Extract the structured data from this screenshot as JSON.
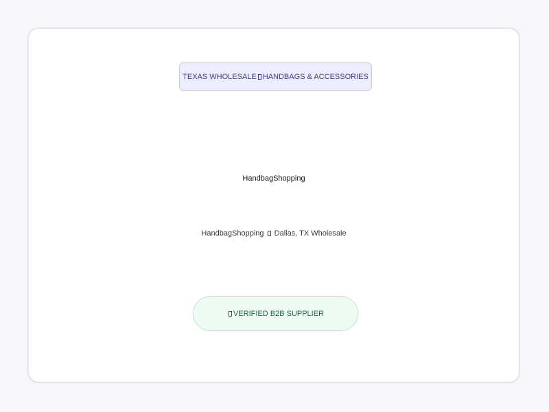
{
  "top_badge": {
    "left_text": "TEXAS WHOLESALE",
    "right_text": "HANDBAGS & ACCESSORIES"
  },
  "brand": {
    "title": "HandbagShopping"
  },
  "subtitle": {
    "left_text": "HandbagShopping",
    "right_text": "Dallas, TX Wholesale"
  },
  "verified_badge": {
    "label": "VERIFIED B2B SUPPLIER"
  },
  "colors": {
    "page_bg": "#f6f7fa",
    "card_bg": "#ffffff",
    "top_badge_bg": "#eceefd",
    "top_badge_text": "#3b3f8f",
    "verified_bg": "#edfbf3",
    "verified_text": "#1f6b3d"
  }
}
